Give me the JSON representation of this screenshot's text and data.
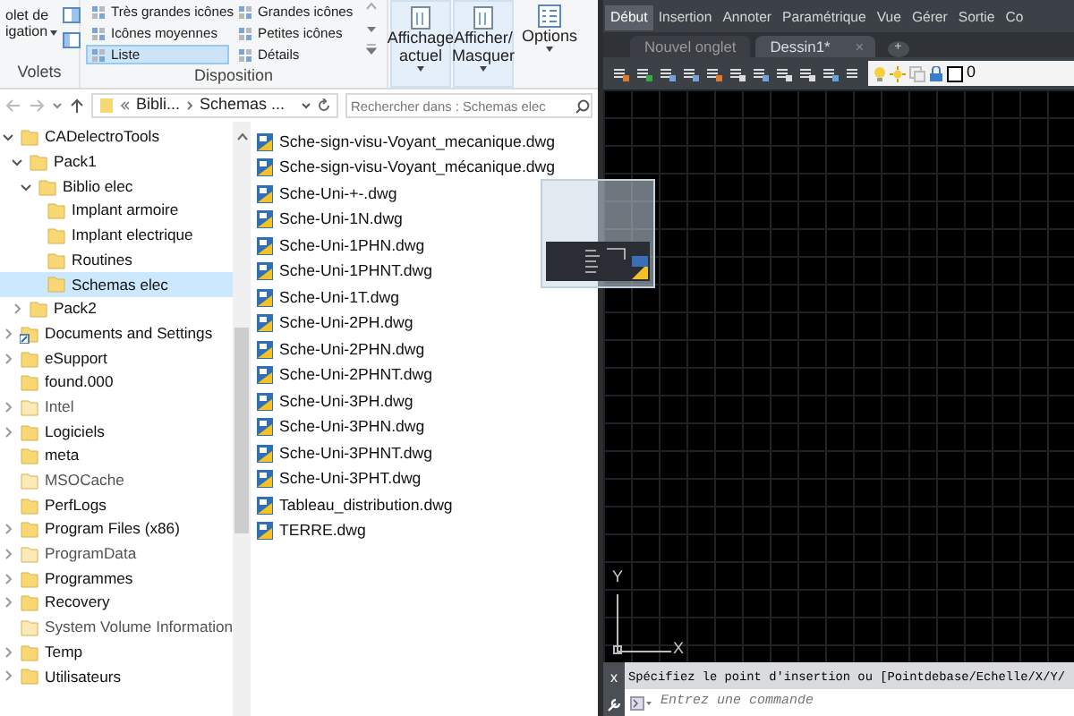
{
  "ribbon": {
    "panes_group": {
      "button_lines": [
        "olet de",
        "igation"
      ],
      "label": "Volets"
    },
    "layout_group": {
      "label": "Disposition",
      "options": [
        {
          "label": "Très grandes icônes",
          "selected": false
        },
        {
          "label": "Grandes icônes",
          "selected": false
        },
        {
          "label": "Icônes moyennes",
          "selected": false
        },
        {
          "label": "Petites icônes",
          "selected": false
        },
        {
          "label": "Liste",
          "selected": true
        },
        {
          "label": "Détails",
          "selected": false
        }
      ]
    },
    "view_buttons": [
      {
        "lines": [
          "Affichage",
          "actuel"
        ],
        "caret": true
      },
      {
        "lines": [
          "Afficher/",
          "Masquer"
        ],
        "caret": true
      },
      {
        "lines": [
          "Options"
        ],
        "caret": true
      }
    ]
  },
  "address_bar": {
    "path": [
      "Bibli...",
      "Schemas ..."
    ],
    "search": {
      "placeholder": "Rechercher dans : Schemas elec"
    }
  },
  "tree": [
    {
      "label": "CADelectroTools",
      "kind": "folder",
      "has_children": true,
      "expanded": true,
      "selected": false,
      "children": [
        {
          "label": "Pack1",
          "kind": "folder",
          "has_children": true,
          "expanded": true,
          "selected": false,
          "children": [
            {
              "label": "Biblio elec",
              "kind": "folder",
              "has_children": true,
              "expanded": true,
              "selected": false,
              "children": [
                {
                  "label": "Implant armoire",
                  "kind": "folder",
                  "has_children": false,
                  "selected": false
                },
                {
                  "label": "Implant electrique",
                  "kind": "folder",
                  "has_children": false,
                  "selected": false
                },
                {
                  "label": "Routines",
                  "kind": "folder",
                  "has_children": false,
                  "selected": false
                },
                {
                  "label": "Schemas elec",
                  "kind": "folder",
                  "has_children": false,
                  "selected": true
                }
              ]
            }
          ]
        },
        {
          "label": "Pack2",
          "kind": "folder",
          "has_children": true,
          "expanded": false,
          "selected": false
        }
      ]
    },
    {
      "label": "Documents and Settings",
      "kind": "link",
      "has_children": true,
      "expanded": false,
      "selected": false
    },
    {
      "label": "eSupport",
      "kind": "folder",
      "has_children": true,
      "expanded": false,
      "selected": false
    },
    {
      "label": "found.000",
      "kind": "folder",
      "has_children": false,
      "selected": false
    },
    {
      "label": "Intel",
      "kind": "hidden",
      "has_children": true,
      "expanded": false,
      "selected": false
    },
    {
      "label": "Logiciels",
      "kind": "folder",
      "has_children": true,
      "expanded": false,
      "selected": false
    },
    {
      "label": "meta",
      "kind": "folder",
      "has_children": false,
      "selected": false
    },
    {
      "label": "MSOCache",
      "kind": "hidden",
      "has_children": false,
      "selected": false
    },
    {
      "label": "PerfLogs",
      "kind": "folder",
      "has_children": false,
      "selected": false
    },
    {
      "label": "Program Files (x86)",
      "kind": "folder",
      "has_children": true,
      "expanded": false,
      "selected": false
    },
    {
      "label": "ProgramData",
      "kind": "hidden",
      "has_children": true,
      "expanded": false,
      "selected": false
    },
    {
      "label": "Programmes",
      "kind": "folder",
      "has_children": true,
      "expanded": false,
      "selected": false
    },
    {
      "label": "Recovery",
      "kind": "folder",
      "has_children": true,
      "expanded": false,
      "selected": false
    },
    {
      "label": "System Volume Information",
      "kind": "hidden",
      "has_children": false,
      "selected": false
    },
    {
      "label": "Temp",
      "kind": "folder",
      "has_children": true,
      "expanded": false,
      "selected": false
    },
    {
      "label": "Utilisateurs",
      "kind": "folder",
      "has_children": true,
      "expanded": false,
      "selected": false
    }
  ],
  "files": [
    "Sche-sign-visu-Voyant_mecanique.dwg",
    "Sche-sign-visu-Voyant_mécanique.dwg",
    "Sche-Uni-+-.dwg",
    "Sche-Uni-1N.dwg",
    "Sche-Uni-1PHN.dwg",
    "Sche-Uni-1PHNT.dwg",
    "Sche-Uni-1T.dwg",
    "Sche-Uni-2PH.dwg",
    "Sche-Uni-2PHN.dwg",
    "Sche-Uni-2PHNT.dwg",
    "Sche-Uni-3PH.dwg",
    "Sche-Uni-3PHN.dwg",
    "Sche-Uni-3PHNT.dwg",
    "Sche-Uni-3PHT.dwg",
    "Tableau_distribution.dwg",
    "TERRE.dwg"
  ],
  "cad": {
    "menu_tabs": [
      {
        "label": "Début",
        "selected": true
      },
      {
        "label": "Insertion",
        "selected": false
      },
      {
        "label": "Annoter",
        "selected": false
      },
      {
        "label": "Paramétrique",
        "selected": false
      },
      {
        "label": "Vue",
        "selected": false
      },
      {
        "label": "Gérer",
        "selected": false
      },
      {
        "label": "Sortie",
        "selected": false
      },
      {
        "label": "Co",
        "selected": false
      }
    ],
    "doc_tabs": [
      {
        "label": "Nouvel onglet",
        "selected": false
      },
      {
        "label": "Dessin1*",
        "selected": true
      }
    ],
    "new_tab": "+",
    "close_mark": "×",
    "layer": "0",
    "axis_labels": {
      "y": "Y",
      "x": "X"
    },
    "command": {
      "close": "x",
      "history": "Spécifiez le point d'insertion ou [Pointdebase/Echelle/X/Y/",
      "placeholder": "Entrez une commande"
    }
  }
}
